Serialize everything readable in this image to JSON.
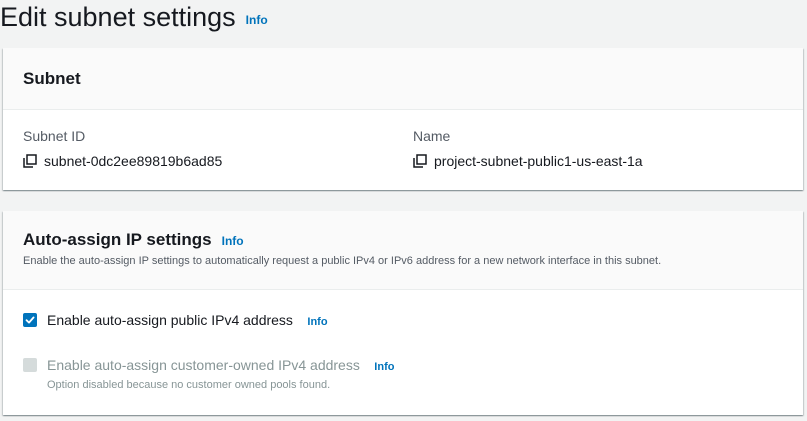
{
  "page": {
    "title": "Edit subnet settings",
    "info": "Info"
  },
  "subnet": {
    "title": "Subnet",
    "subnet_id_label": "Subnet ID",
    "subnet_id_value": "subnet-0dc2ee89819b6ad85",
    "name_label": "Name",
    "name_value": "project-subnet-public1-us-east-1a"
  },
  "auto_assign": {
    "title": "Auto-assign IP settings",
    "info": "Info",
    "description": "Enable the auto-assign IP settings to automatically request a public IPv4 or IPv6 address for a new network interface in this subnet.",
    "options": [
      {
        "label": "Enable auto-assign public IPv4 address",
        "info": "Info",
        "checked": true,
        "disabled": false
      },
      {
        "label": "Enable auto-assign customer-owned IPv4 address",
        "info": "Info",
        "checked": false,
        "disabled": true,
        "description": "Option disabled because no customer owned pools found."
      }
    ]
  },
  "colors": {
    "link": "#0073bb",
    "checkbox_checked": "#0073bb",
    "checkbox_disabled": "#d5dbdb",
    "background": "#f2f3f3"
  },
  "icons": {
    "copy": "copy-icon",
    "check": "checkmark-icon"
  }
}
